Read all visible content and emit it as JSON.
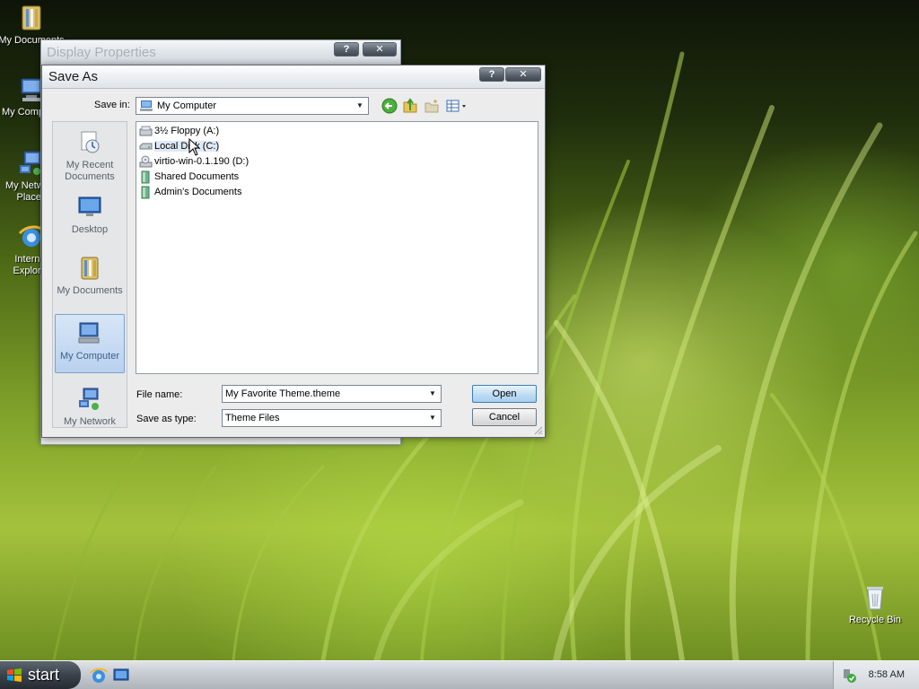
{
  "desktop": {
    "icons": [
      {
        "label": "My Documents"
      },
      {
        "label": "My Computer"
      },
      {
        "label": "My Network Places"
      },
      {
        "label": "Internet Explorer"
      },
      {
        "label": "Recycle Bin"
      }
    ]
  },
  "background_window": {
    "title": "Display Properties",
    "help_label": "?",
    "close_label": "✕"
  },
  "dialog": {
    "title": "Save As",
    "help_label": "?",
    "close_label": "✕",
    "save_in": {
      "label": "Save in:",
      "value": "My Computer"
    },
    "places": [
      {
        "label": "My Recent Documents",
        "icon": "recent-documents-icon",
        "selected": false
      },
      {
        "label": "Desktop",
        "icon": "desktop-icon",
        "selected": false
      },
      {
        "label": "My Documents",
        "icon": "my-documents-icon",
        "selected": false
      },
      {
        "label": "My Computer",
        "icon": "my-computer-icon",
        "selected": true
      },
      {
        "label": "My Network",
        "icon": "my-network-icon",
        "selected": false
      }
    ],
    "files": [
      {
        "name": "3½ Floppy (A:)",
        "icon": "floppy-drive-icon"
      },
      {
        "name": "Local Disk (C:)",
        "icon": "hard-disk-icon"
      },
      {
        "name": "virtio-win-0.1.190 (D:)",
        "icon": "cd-drive-icon"
      },
      {
        "name": "Shared Documents",
        "icon": "folder-icon"
      },
      {
        "name": "Admin's Documents",
        "icon": "folder-icon"
      }
    ],
    "file_name": {
      "label": "File name:",
      "value": "My Favorite Theme.theme"
    },
    "save_as_type": {
      "label": "Save as type:",
      "value": "Theme Files"
    },
    "open_button": "Open",
    "cancel_button": "Cancel"
  },
  "taskbar": {
    "start_label": "start",
    "clock": "8:58 AM"
  }
}
